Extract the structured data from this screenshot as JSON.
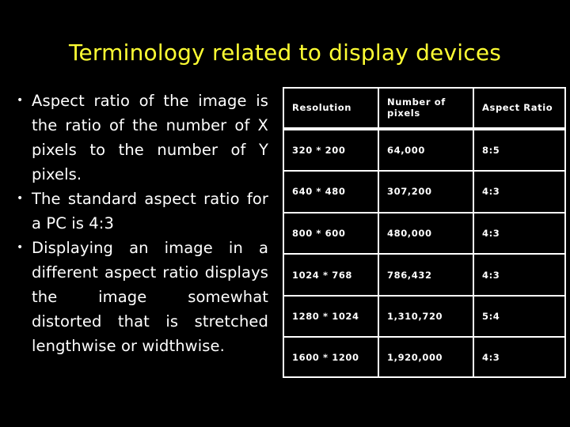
{
  "slide": {
    "title": "Terminology related to display devices",
    "title_color": "#ffff33",
    "background_color": "#000000",
    "text_color": "#ffffff"
  },
  "bullets": [
    {
      "text": "Aspect ratio of the image is the ratio of the number of X pixels to the number of Y pixels."
    },
    {
      "text": "The standard aspect ratio for a PC is 4:3"
    },
    {
      "text": "Displaying an image in a different aspect ratio displays the image somewhat distorted that is stretched lengthwise or widthwise."
    }
  ],
  "table": {
    "headers": [
      "Resolution",
      "Number of pixels",
      "Aspect Ratio"
    ],
    "rows": [
      {
        "resolution": "320 * 200",
        "pixels": "64,000",
        "aspect": "8:5"
      },
      {
        "resolution": "640 * 480",
        "pixels": "307,200",
        "aspect": "4:3"
      },
      {
        "resolution": "800 * 600",
        "pixels": "480,000",
        "aspect": "4:3"
      },
      {
        "resolution": "1024 * 768",
        "pixels": "786,432",
        "aspect": "4:3"
      },
      {
        "resolution": "1280 * 1024",
        "pixels": "1,310,720",
        "aspect": "5:4"
      },
      {
        "resolution": "1600 * 1200",
        "pixels": "1,920,000",
        "aspect": "4:3"
      }
    ]
  }
}
